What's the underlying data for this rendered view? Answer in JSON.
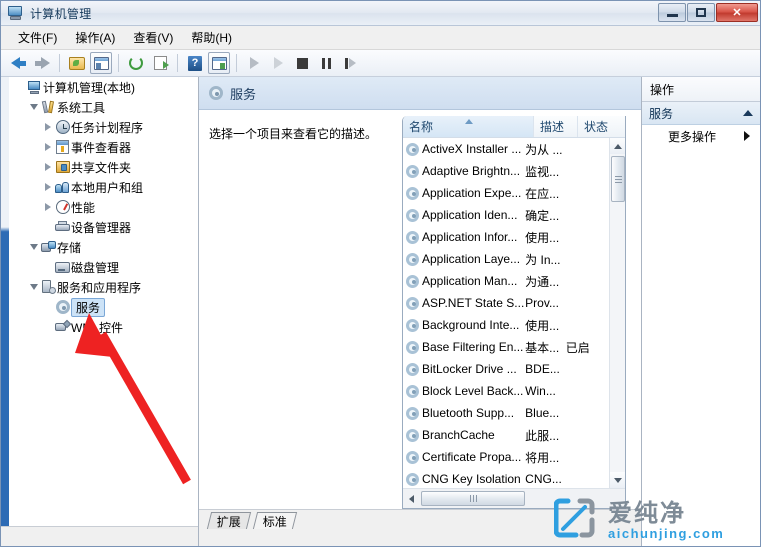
{
  "window": {
    "title": "计算机管理",
    "title_icon": "computer-management-icon",
    "controls": {
      "minimize": "–",
      "maximize": "□",
      "close": "✕"
    }
  },
  "menubar": {
    "items": [
      {
        "label": "文件(F)",
        "name": "menu-file"
      },
      {
        "label": "操作(A)",
        "name": "menu-action"
      },
      {
        "label": "查看(V)",
        "name": "menu-view"
      },
      {
        "label": "帮助(H)",
        "name": "menu-help"
      }
    ]
  },
  "toolbar": {
    "buttons": [
      {
        "name": "back-icon",
        "icon": "arrow-left"
      },
      {
        "name": "forward-icon",
        "icon": "arrow-right"
      },
      {
        "name": "up-folder-icon",
        "icon": "folder"
      },
      {
        "name": "show-console-tree-icon",
        "icon": "pane-left"
      },
      {
        "name": "refresh-icon",
        "icon": "refresh"
      },
      {
        "name": "export-list-icon",
        "icon": "export"
      },
      {
        "name": "help-icon",
        "icon": "question"
      },
      {
        "name": "show-action-pane-icon",
        "icon": "pane-right"
      },
      {
        "name": "start-service-icon",
        "icon": "play"
      },
      {
        "name": "resume-service-icon",
        "icon": "play-disabled"
      },
      {
        "name": "stop-service-icon",
        "icon": "stop"
      },
      {
        "name": "pause-service-icon",
        "icon": "pause"
      },
      {
        "name": "restart-service-icon",
        "icon": "step"
      }
    ]
  },
  "tree": {
    "nodes": [
      {
        "label": "计算机管理(本地)",
        "indent": 0,
        "toggle": "none",
        "icon": "computer",
        "selected": false
      },
      {
        "label": "系统工具",
        "indent": 1,
        "toggle": "expanded",
        "icon": "tools",
        "selected": false
      },
      {
        "label": "任务计划程序",
        "indent": 2,
        "toggle": "collapsed",
        "icon": "clock",
        "selected": false
      },
      {
        "label": "事件查看器",
        "indent": 2,
        "toggle": "collapsed",
        "icon": "event",
        "selected": false
      },
      {
        "label": "共享文件夹",
        "indent": 2,
        "toggle": "collapsed",
        "icon": "share",
        "selected": false
      },
      {
        "label": "本地用户和组",
        "indent": 2,
        "toggle": "collapsed",
        "icon": "users",
        "selected": false
      },
      {
        "label": "性能",
        "indent": 2,
        "toggle": "collapsed",
        "icon": "performance",
        "selected": false
      },
      {
        "label": "设备管理器",
        "indent": 2,
        "toggle": "none",
        "icon": "device",
        "selected": false
      },
      {
        "label": "存储",
        "indent": 1,
        "toggle": "expanded",
        "icon": "storage",
        "selected": false
      },
      {
        "label": "磁盘管理",
        "indent": 2,
        "toggle": "none",
        "icon": "disk",
        "selected": false
      },
      {
        "label": "服务和应用程序",
        "indent": 1,
        "toggle": "expanded",
        "icon": "services-apps",
        "selected": false
      },
      {
        "label": "服务",
        "indent": 2,
        "toggle": "none",
        "icon": "gear",
        "selected": true
      },
      {
        "label": "WMI 控件",
        "indent": 2,
        "toggle": "none",
        "icon": "wmi",
        "selected": false
      }
    ]
  },
  "details": {
    "header_title": "服务",
    "header_icon": "gear-icon",
    "description": "选择一个项目来查看它的描述。"
  },
  "list": {
    "columns": [
      {
        "label": "名称",
        "name": "column-name",
        "sorted": "asc"
      },
      {
        "label": "描述",
        "name": "column-description",
        "sorted": "none"
      },
      {
        "label": "状态",
        "name": "column-status",
        "sorted": "none"
      }
    ],
    "rows": [
      {
        "name": "ActiveX Installer ...",
        "description": "为从 ...",
        "status": ""
      },
      {
        "name": "Adaptive Brightn...",
        "description": "监视...",
        "status": ""
      },
      {
        "name": "Application Expe...",
        "description": "在应...",
        "status": ""
      },
      {
        "name": "Application Iden...",
        "description": "确定...",
        "status": ""
      },
      {
        "name": "Application Infor...",
        "description": "使用...",
        "status": ""
      },
      {
        "name": "Application Laye...",
        "description": "为 In...",
        "status": ""
      },
      {
        "name": "Application Man...",
        "description": "为通...",
        "status": ""
      },
      {
        "name": "ASP.NET State S...",
        "description": "Prov...",
        "status": ""
      },
      {
        "name": "Background Inte...",
        "description": "使用...",
        "status": ""
      },
      {
        "name": "Base Filtering En...",
        "description": "基本...",
        "status": "已启"
      },
      {
        "name": "BitLocker Drive ...",
        "description": "BDE...",
        "status": ""
      },
      {
        "name": "Block Level Back...",
        "description": "Win...",
        "status": ""
      },
      {
        "name": "Bluetooth Supp...",
        "description": "Blue...",
        "status": ""
      },
      {
        "name": "BranchCache",
        "description": "此服...",
        "status": ""
      },
      {
        "name": "Certificate Propa...",
        "description": "将用...",
        "status": ""
      },
      {
        "name": "CNG Key Isolation",
        "description": "CNG...",
        "status": ""
      }
    ]
  },
  "tabs": [
    {
      "label": "扩展",
      "name": "tab-extended",
      "active": false
    },
    {
      "label": "标准",
      "name": "tab-standard",
      "active": true
    }
  ],
  "actions": {
    "header": "操作",
    "section_title": "服务",
    "items": [
      {
        "label": "更多操作",
        "name": "action-more-actions"
      }
    ]
  },
  "watermark": {
    "cn": "爱纯净",
    "en": "aichunjing.com",
    "logo_blue": "#2f9fe0",
    "logo_gray": "#8b959f"
  },
  "annotation": {
    "arrow_color": "#ee2222",
    "points_to": "服务"
  }
}
